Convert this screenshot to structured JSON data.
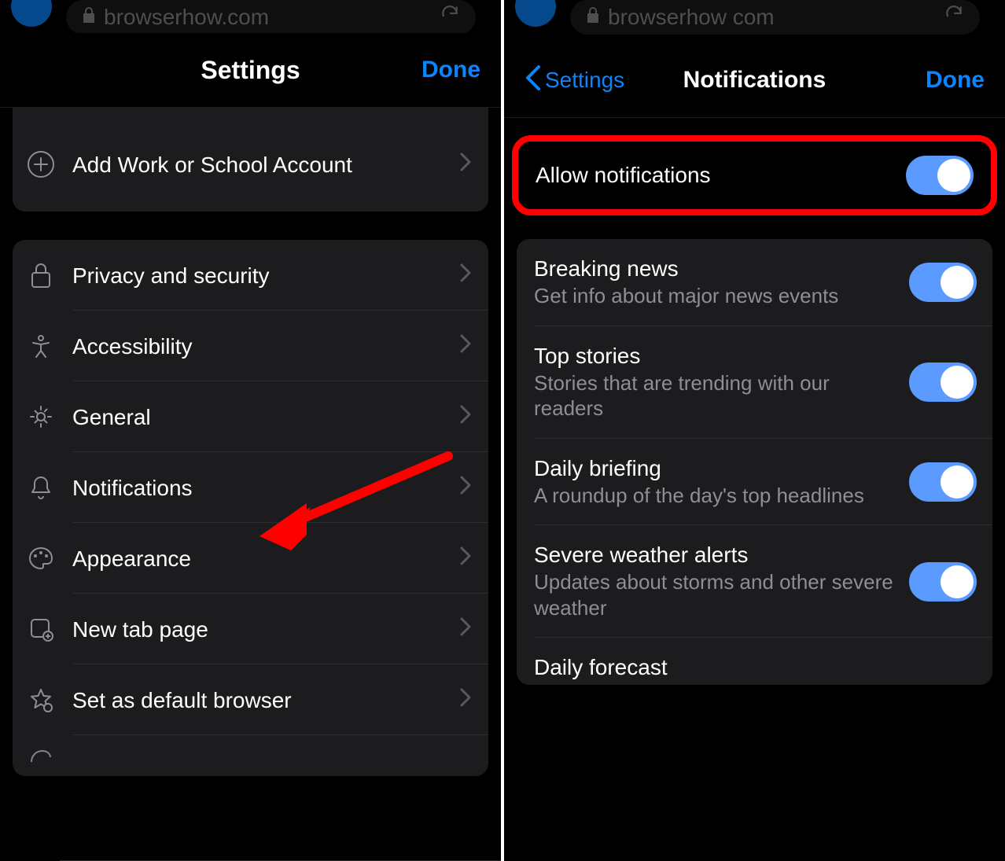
{
  "left": {
    "url": "browserhow.com",
    "nav_title": "Settings",
    "nav_done": "Done",
    "add_account": "Add Work or School Account",
    "items": [
      {
        "label": "Privacy and security"
      },
      {
        "label": "Accessibility"
      },
      {
        "label": "General"
      },
      {
        "label": "Notifications"
      },
      {
        "label": "Appearance"
      },
      {
        "label": "New tab page"
      },
      {
        "label": "Set as default browser"
      }
    ]
  },
  "right": {
    "url": "browserhow com",
    "nav_back": "Settings",
    "nav_title": "Notifications",
    "nav_done": "Done",
    "allow_label": "Allow notifications",
    "allow_state": true,
    "options": [
      {
        "title": "Breaking news",
        "sub": "Get info about major news events",
        "state": true
      },
      {
        "title": "Top stories",
        "sub": "Stories that are trending with our readers",
        "state": true
      },
      {
        "title": "Daily briefing",
        "sub": "A roundup of the day's top headlines",
        "state": true
      },
      {
        "title": "Severe weather alerts",
        "sub": "Updates about storms and other severe weather",
        "state": true
      },
      {
        "title": "Daily forecast",
        "sub": "",
        "state": true
      }
    ]
  },
  "annotation": {
    "type": "arrow",
    "points_to": "Notifications"
  }
}
